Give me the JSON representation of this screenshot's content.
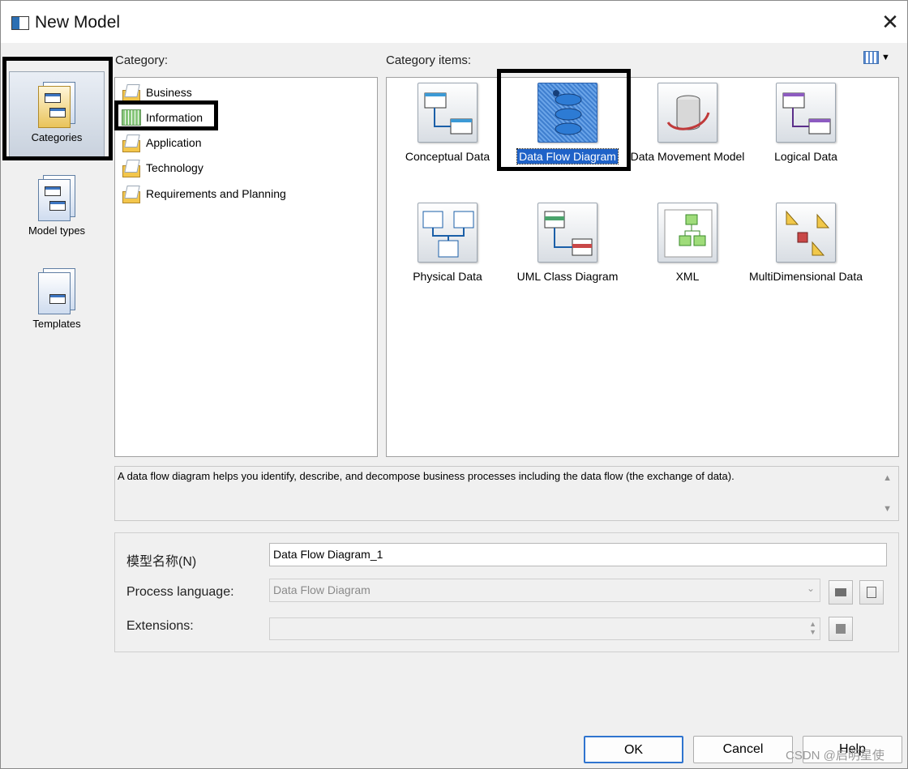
{
  "window": {
    "title": "New Model",
    "close_glyph": "✕"
  },
  "nav": {
    "items": [
      {
        "label": "Categories",
        "icon": "categories-icon",
        "selected": true
      },
      {
        "label": "Model types",
        "icon": "model-types-icon",
        "selected": false
      },
      {
        "label": "Templates",
        "icon": "templates-icon",
        "selected": false
      }
    ]
  },
  "category": {
    "heading": "Category:",
    "items": [
      {
        "label": "Business",
        "icon": "folder-icon"
      },
      {
        "label": "Information",
        "icon": "grid-icon"
      },
      {
        "label": "Application",
        "icon": "folder-icon"
      },
      {
        "label": "Technology",
        "icon": "folder-icon"
      },
      {
        "label": "Requirements and Planning",
        "icon": "folder-icon"
      }
    ]
  },
  "category_items": {
    "heading": "Category items:",
    "view_arrow": "▼",
    "tiles": [
      {
        "label": "Conceptual Data",
        "icon": "conceptual-data-icon"
      },
      {
        "label": "Data Flow Diagram",
        "icon": "data-flow-diagram-icon",
        "selected": true
      },
      {
        "label": "Data Movement Model",
        "icon": "data-movement-icon"
      },
      {
        "label": "Logical Data",
        "icon": "logical-data-icon"
      },
      {
        "label": "Physical Data",
        "icon": "physical-data-icon"
      },
      {
        "label": "UML Class Diagram",
        "icon": "uml-class-icon"
      },
      {
        "label": "XML",
        "icon": "xml-icon"
      },
      {
        "label": "MultiDimensional Data",
        "icon": "multidimensional-icon"
      }
    ]
  },
  "description": "A data flow diagram helps you identify, describe, and decompose business processes including the data flow (the exchange of data).",
  "scroll": {
    "up": "▲",
    "down": "▼"
  },
  "properties": {
    "model_name_label": "模型名称(N)",
    "model_name_value": "Data Flow Diagram_1",
    "process_language_label": "Process language:",
    "process_language_value": "Data Flow Diagram",
    "extensions_label": "Extensions:",
    "extensions_value": ""
  },
  "buttons": {
    "ok": "OK",
    "cancel": "Cancel",
    "help": "Help"
  },
  "watermark": "CSDN @启明星使"
}
